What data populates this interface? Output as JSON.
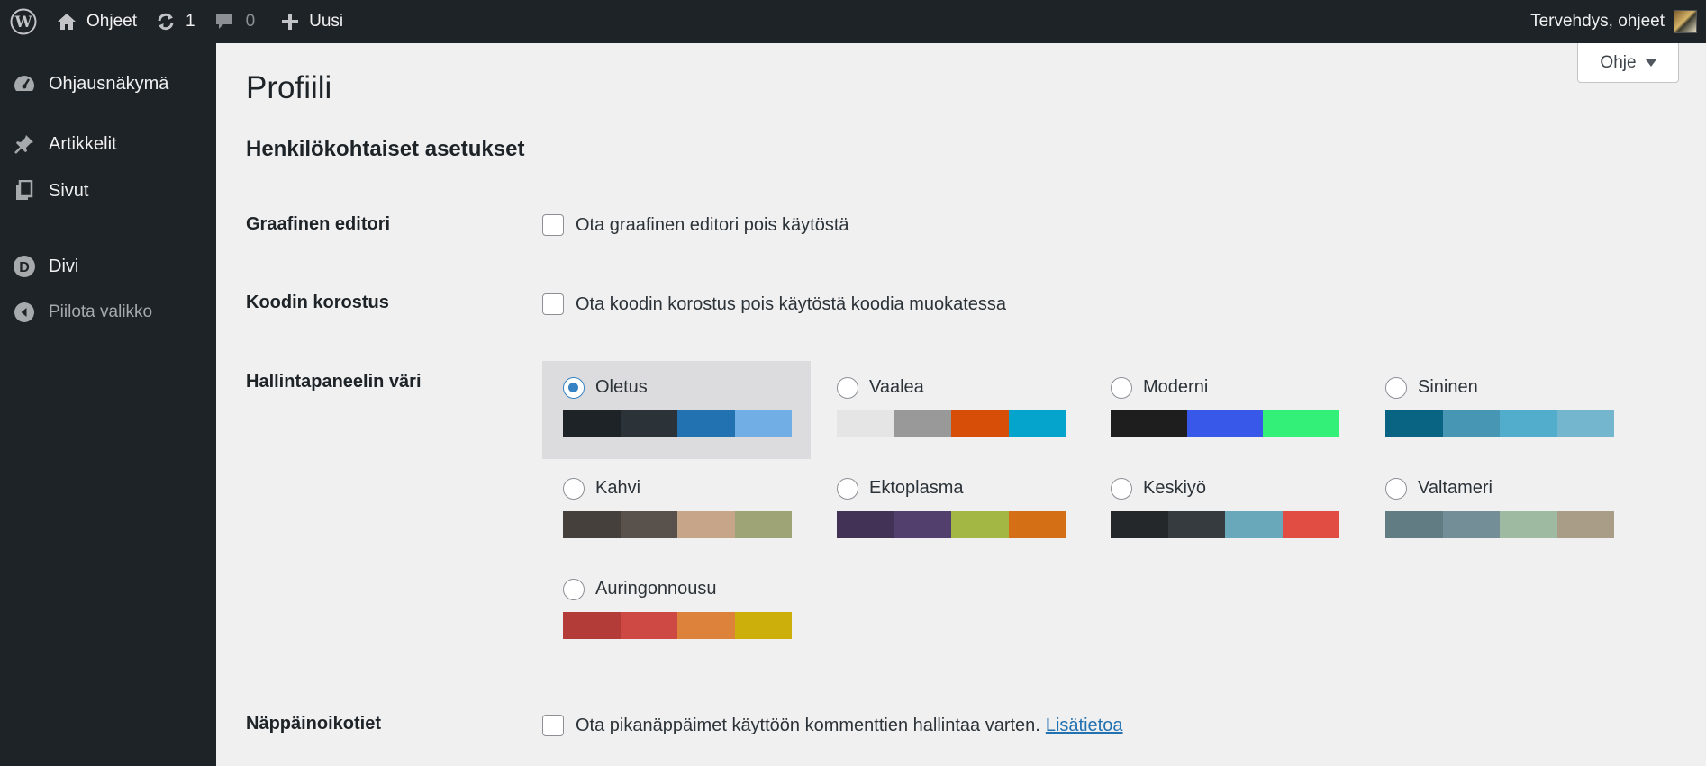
{
  "adminbar": {
    "site_name": "Ohjeet",
    "updates_count": "1",
    "comments_count": "0",
    "new_label": "Uusi",
    "greeting": "Tervehdys, ohjeet"
  },
  "sidebar": {
    "items": [
      {
        "label": "Ohjausnäkymä",
        "icon": "dashboard-icon"
      },
      {
        "label": "Artikkelit",
        "icon": "pin-icon"
      },
      {
        "label": "Sivut",
        "icon": "pages-icon"
      },
      {
        "label": "Divi",
        "icon": "divi-icon"
      },
      {
        "label": "Piilota valikko",
        "icon": "collapse-icon"
      }
    ]
  },
  "main": {
    "help_label": "Ohje",
    "page_title": "Profiili",
    "section_title": "Henkilökohtaiset asetukset",
    "visual_editor": {
      "label": "Graafinen editori",
      "checkbox_label": "Ota graafinen editori pois käytöstä",
      "checked": false
    },
    "syntax_highlight": {
      "label": "Koodin korostus",
      "checkbox_label": "Ota koodin korostus pois käytöstä koodia muokatessa",
      "checked": false
    },
    "admin_color": {
      "label": "Hallintapaneelin väri",
      "selected": "Oletus",
      "schemes": [
        {
          "name": "Oletus",
          "colors": [
            "#1d2327",
            "#2c3338",
            "#2271b1",
            "#72aee6"
          ]
        },
        {
          "name": "Vaalea",
          "colors": [
            "#e5e5e5",
            "#999999",
            "#d64e07",
            "#04a4cc"
          ]
        },
        {
          "name": "Moderni",
          "colors": [
            "#1e1e1e",
            "#3858e9",
            "#33f078"
          ]
        },
        {
          "name": "Sininen",
          "colors": [
            "#096484",
            "#4796b3",
            "#52accc",
            "#74b6ce"
          ]
        },
        {
          "name": "Kahvi",
          "colors": [
            "#46403c",
            "#59524c",
            "#c7a589",
            "#9ea476"
          ]
        },
        {
          "name": "Ektoplasma",
          "colors": [
            "#413256",
            "#523f6d",
            "#a3b745",
            "#d46f15"
          ]
        },
        {
          "name": "Keskiyö",
          "colors": [
            "#25282b",
            "#363b3f",
            "#69a8bb",
            "#e14d43"
          ]
        },
        {
          "name": "Valtameri",
          "colors": [
            "#627c83",
            "#738e96",
            "#9ebaa0",
            "#aa9d88"
          ]
        },
        {
          "name": "Auringonnousu",
          "colors": [
            "#b43c38",
            "#cf4944",
            "#dd823b",
            "#ccaf0b"
          ]
        }
      ]
    },
    "keyboard_shortcuts": {
      "label": "Näppäinoikotiet",
      "checkbox_label": "Ota pikanäppäimet käyttöön kommenttien hallintaa varten.",
      "link_label": "Lisätietoa",
      "checked": false
    }
  }
}
